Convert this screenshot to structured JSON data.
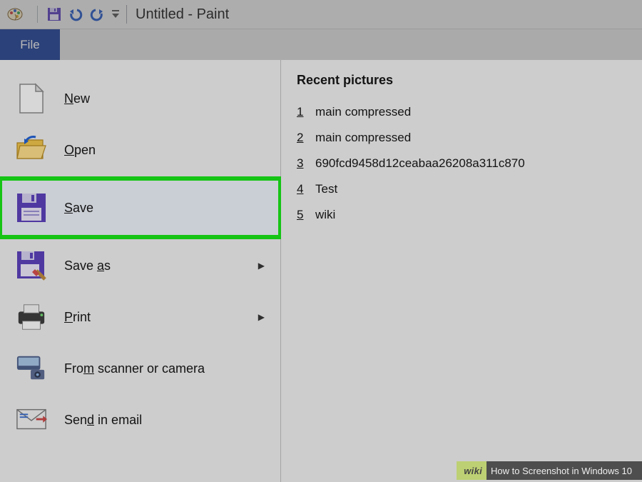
{
  "title": {
    "document": "Untitled - Paint"
  },
  "qat": {
    "save_icon": "floppy-icon",
    "undo_icon": "undo-icon",
    "redo_icon": "redo-icon",
    "customize_icon": "dropdown-icon"
  },
  "ribbon": {
    "file_tab": "File"
  },
  "file_menu": {
    "items": [
      {
        "id": "new",
        "label": "New",
        "mnemonic": "N",
        "has_sub": false
      },
      {
        "id": "open",
        "label": "Open",
        "mnemonic": "O",
        "has_sub": false
      },
      {
        "id": "save",
        "label": "Save",
        "mnemonic": "S",
        "has_sub": false,
        "highlighted": true
      },
      {
        "id": "saveas",
        "label": "Save as",
        "mnemonic": "a",
        "has_sub": true
      },
      {
        "id": "print",
        "label": "Print",
        "mnemonic": "P",
        "has_sub": true
      },
      {
        "id": "scanner",
        "label": "From scanner or camera",
        "mnemonic": "m",
        "has_sub": false
      },
      {
        "id": "email",
        "label": "Send in email",
        "mnemonic": "d",
        "has_sub": false
      }
    ]
  },
  "recent": {
    "header": "Recent pictures",
    "items": [
      {
        "n": "1",
        "name": "main compressed"
      },
      {
        "n": "2",
        "name": "main compressed"
      },
      {
        "n": "3",
        "name": "690fcd9458d12ceabaa26208a311c870"
      },
      {
        "n": "4",
        "name": "Test"
      },
      {
        "n": "5",
        "name": "wiki"
      }
    ]
  },
  "caption": {
    "left": "wiki",
    "right": "How to Screenshot in Windows 10"
  }
}
